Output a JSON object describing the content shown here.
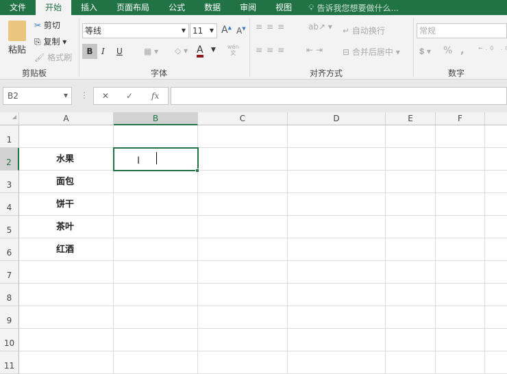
{
  "tabs": [
    "文件",
    "开始",
    "插入",
    "页面布局",
    "公式",
    "数据",
    "审阅",
    "视图"
  ],
  "active_tab": "开始",
  "tell_me": "告诉我您想要做什么...",
  "clipboard": {
    "paste": "粘贴",
    "cut": "剪切",
    "copy": "复制",
    "format_painter": "格式刷",
    "label": "剪贴板"
  },
  "font": {
    "name": "等线",
    "size": "11",
    "bold": "B",
    "italic": "I",
    "underline": "U",
    "phonetic": "wén",
    "phonetic2": "文",
    "label": "字体",
    "font_color": "#8b1a1a"
  },
  "alignment": {
    "wrap": "自动换行",
    "merge": "合并后居中",
    "label": "对齐方式"
  },
  "number": {
    "format": "常规",
    "percent": "%",
    "comma": ",",
    "label": "数字"
  },
  "formula_bar": {
    "name_box": "B2",
    "cancel": "✕",
    "enter": "✓",
    "fx": "fx",
    "value": ""
  },
  "columns": [
    "A",
    "B",
    "C",
    "D",
    "E",
    "F"
  ],
  "selected_cell": "B2",
  "rows": [
    "1",
    "2",
    "3",
    "4",
    "5",
    "6",
    "7",
    "8",
    "9",
    "10",
    "11"
  ],
  "cells": {
    "A2": "水果",
    "A3": "面包",
    "A4": "饼干",
    "A5": "茶叶",
    "A6": "红酒"
  },
  "accent": "#217346"
}
